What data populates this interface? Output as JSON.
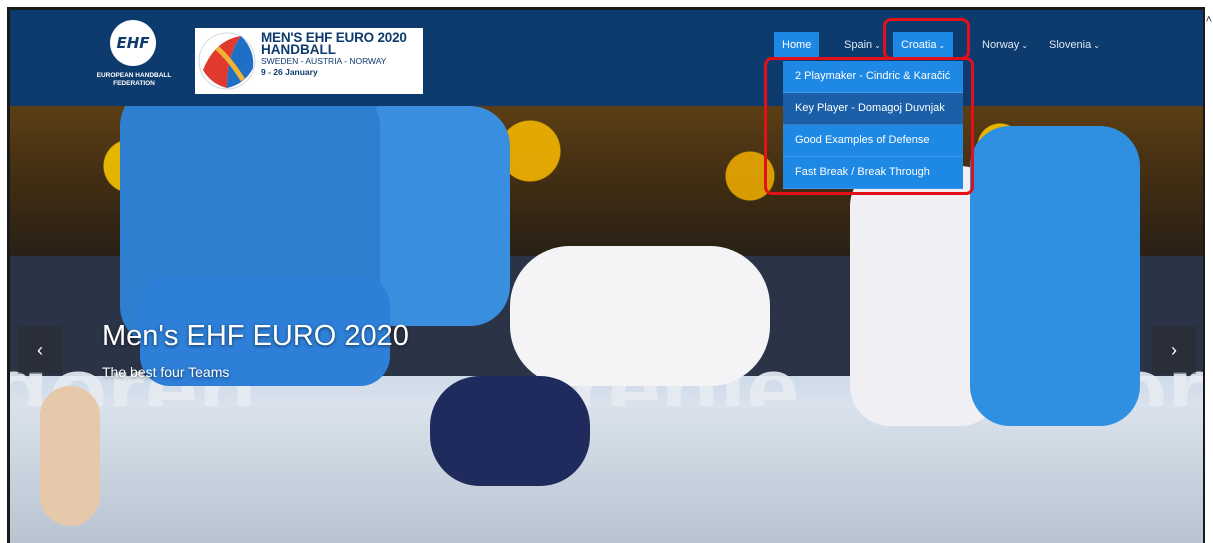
{
  "header": {
    "logo_text": "EHF",
    "logo_caption": "EUROPEAN HANDBALL FEDERATION",
    "banner": {
      "line1": "MEN'S EHF EURO 2020",
      "line2": "HANDBALL",
      "line3": "SWEDEN - AUSTRIA - NORWAY",
      "line4": "9 - 26 January"
    }
  },
  "nav": {
    "items": [
      {
        "label": "Home"
      },
      {
        "label": "Spain"
      },
      {
        "label": "Croatia"
      },
      {
        "label": "Norway"
      },
      {
        "label": "Slovenia"
      }
    ],
    "caret": "⌄"
  },
  "dropdown": {
    "items": [
      {
        "label": "2 Playmaker - Cindric & Karačić"
      },
      {
        "label": "Key Player - Domagoj Duvnjak"
      },
      {
        "label": "Good Examples of Defense"
      },
      {
        "label": "Fast Break / Break Through"
      }
    ]
  },
  "hero": {
    "title": "Men's EHF EURO 2020",
    "subtitle": "The best four Teams",
    "ad_text_left": "goren",
    "ad_text_mid": "renje",
    "ad_text_right": "gor"
  },
  "carousel": {
    "prev_icon": "‹",
    "next_icon": "›"
  },
  "colors": {
    "header_bg": "#0d3b6e",
    "nav_active": "#1e88e5",
    "highlight": "#e3101a"
  }
}
